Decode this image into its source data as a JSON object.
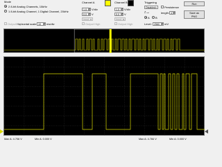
{
  "mode": {
    "label": "Mode",
    "option1": "2 8-bit Analog Channels, 10kHz",
    "option2": "1 8-bit Analog Channel, 1 Digital Channel, 20kHz",
    "selected": "option1"
  },
  "horizontal": {
    "label": "Horizontal scale:",
    "value": "10",
    "unit": "ms/div"
  },
  "output_high_1": "Output High",
  "output_high_2": "Output High",
  "output_high_3": "Output High",
  "channel_a": {
    "label": "Channel A",
    "color": "#ffff00",
    "scale_value": "1.0",
    "scale_unit": "V/div",
    "offset_value": "0.0",
    "offset_unit": "V",
    "input": "Input"
  },
  "channel_b": {
    "label": "Channel B",
    "color": "#000000",
    "scale_value": "1.0",
    "scale_unit": "V/div",
    "offset_value": "0.0",
    "offset_unit": "V",
    "input": "Input"
  },
  "triggering": {
    "label": "Triggering",
    "mode": "Disabled",
    "channel_a": "A",
    "channel_b": "B",
    "selected_channel": "A",
    "level_label": "Level:",
    "level_value": "2560",
    "level_unit": "mV"
  },
  "persistence": {
    "label": "Persistence",
    "checked": false
  },
  "length": {
    "label": "length:",
    "value": "4"
  },
  "buttons": {
    "run": "Run",
    "save_line1": "Save as",
    "save_line2": "PNG"
  },
  "status_bar": {
    "max_a": "Max A: 4.706 V",
    "min_a": "Min A: 0.000 V",
    "max_b": "Max A: 4.784 V",
    "min_b": "Min A: 0.000 V"
  },
  "colors": {
    "trace": "#d9d900",
    "marker": "#ffff00",
    "background": "#000000"
  },
  "overview_window": {
    "start": 0.35,
    "end": 0.53
  }
}
